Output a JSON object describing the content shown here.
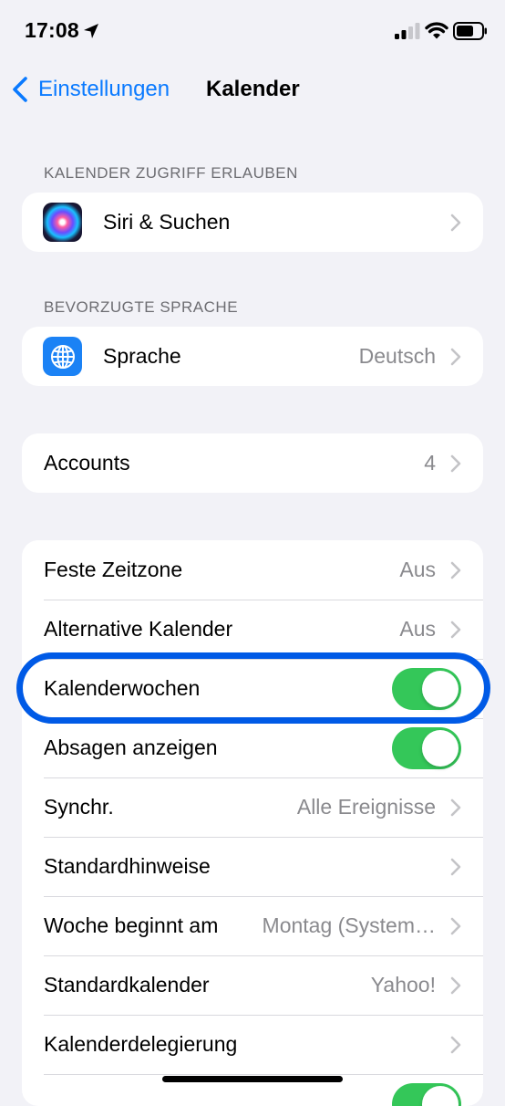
{
  "status_bar": {
    "time": "17:08"
  },
  "nav": {
    "back_label": "Einstellungen",
    "title": "Kalender"
  },
  "sections": {
    "access_header": "KALENDER ZUGRIFF ERLAUBEN",
    "language_header": "BEVORZUGTE SPRACHE"
  },
  "access": {
    "siri_label": "Siri & Suchen"
  },
  "language": {
    "label": "Sprache",
    "value": "Deutsch"
  },
  "accounts": {
    "label": "Accounts",
    "value": "4"
  },
  "settings": {
    "time_zone": {
      "label": "Feste Zeitzone",
      "value": "Aus"
    },
    "alt_calendars": {
      "label": "Alternative Kalender",
      "value": "Aus"
    },
    "week_numbers": {
      "label": "Kalenderwochen",
      "on": true
    },
    "show_declined": {
      "label": "Absagen anzeigen",
      "on": true
    },
    "sync": {
      "label": "Synchr.",
      "value": "Alle Ereignisse"
    },
    "default_alerts": {
      "label": "Standardhinweise"
    },
    "week_start": {
      "label": "Woche beginnt am",
      "value": "Montag (System…"
    },
    "default_calendar": {
      "label": "Standardkalender",
      "value": "Yahoo!"
    },
    "delegation": {
      "label": "Kalenderdelegierung"
    }
  },
  "colors": {
    "accent": "#0a7aff",
    "toggle_on": "#34c759",
    "highlight": "#005ae6"
  }
}
